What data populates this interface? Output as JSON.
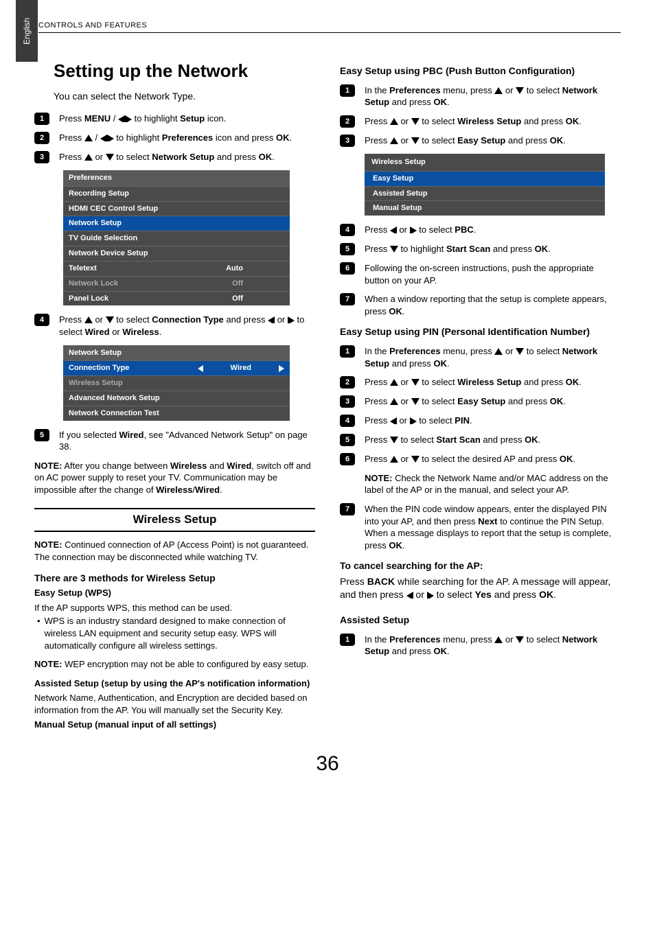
{
  "side_tab": "English",
  "header": "CONTROLS AND FEATURES",
  "page_number": "36",
  "left": {
    "title": "Setting up the Network",
    "intro": "You can select the Network Type.",
    "steps": {
      "s1_a": "Press ",
      "s1_b": "MENU",
      "s1_c": " / ",
      "s1_d": " to highlight ",
      "s1_e": "Setup",
      "s1_f": " icon.",
      "s2_a": "Press ",
      "s2_b": " / ",
      "s2_c": " to highlight ",
      "s2_d": "Preferences",
      "s2_e": " icon and press ",
      "s2_f": "OK",
      "s2_g": ".",
      "s3_a": "Press ",
      "s3_b": " or ",
      "s3_c": " to select ",
      "s3_d": "Network Setup",
      "s3_e": " and press ",
      "s3_f": "OK",
      "s3_g": ".",
      "s4_a": "Press ",
      "s4_b": " or ",
      "s4_c": " to select ",
      "s4_d": "Connection Type",
      "s4_e": " and press ",
      "s4_f": " or ",
      "s4_g": " to select ",
      "s4_h": "Wired",
      "s4_i": " or ",
      "s4_j": "Wireless",
      "s4_k": ".",
      "s5_a": "If you selected ",
      "s5_b": "Wired",
      "s5_c": ", see \"Advanced Network Setup\" on page 38."
    },
    "menu1": {
      "head": "Preferences",
      "rows": [
        {
          "label": "Recording Setup",
          "val": ""
        },
        {
          "label": "HDMI CEC Control Setup",
          "val": ""
        },
        {
          "label": "Network Setup",
          "val": "",
          "selected": true
        },
        {
          "label": "TV Guide Selection",
          "val": ""
        },
        {
          "label": "Network Device Setup",
          "val": ""
        },
        {
          "label": "Teletext",
          "val": "Auto"
        },
        {
          "label": "Network Lock",
          "val": "Off",
          "dim": true
        },
        {
          "label": "Panel Lock",
          "val": "Off"
        }
      ]
    },
    "menu2": {
      "head": "Network Setup",
      "rows": [
        {
          "label": "Connection Type",
          "val": "Wired",
          "selected": true,
          "arrows": true
        },
        {
          "label": "Wireless Setup",
          "val": "",
          "dim": true
        },
        {
          "label": "Advanced Network Setup",
          "val": ""
        },
        {
          "label": "Network Connection Test",
          "val": ""
        }
      ]
    },
    "note1_a": "NOTE:",
    "note1_b": "  After you change between ",
    "note1_c": "Wireless",
    "note1_d": " and ",
    "note1_e": "Wired",
    "note1_f": ", switch off and on AC power supply to reset your TV. Communication may be impossible after the change of ",
    "note1_g": "Wireless",
    "note1_h": "/",
    "note1_i": "Wired",
    "note1_j": ".",
    "section_title": "Wireless Setup",
    "note2_a": "NOTE:",
    "note2_b": " Continued connection of AP (Access Point) is not guaranteed. The connection may be disconnected while watching TV.",
    "methods_head": "There are 3 methods for Wireless Setup",
    "easy_wps": "Easy Setup (WPS)",
    "easy_wps_body": "If the AP supports WPS, this method can be used.",
    "easy_wps_bullet": "WPS is an industry standard designed to make connection of wireless LAN equipment and security setup easy. WPS will automatically configure all wireless settings.",
    "note3_a": "NOTE:",
    "note3_b": "  WEP encryption may not be able to configured by easy setup.",
    "assisted_head": "Assisted Setup (setup by using the AP's notification information)",
    "assisted_body": "Network Name, Authentication, and Encryption are decided based on information from the AP. You will manually set the Security Key.",
    "manual_head": "Manual Setup (manual input of all settings)"
  },
  "right": {
    "pbc_head": "Easy Setup using PBC (Push Button Configuration)",
    "pbc": {
      "s1_a": "In the ",
      "s1_b": "Preferences",
      "s1_c": " menu, press ",
      "s1_d": " or ",
      "s1_e": " to select ",
      "s1_f": "Network Setup",
      "s1_g": " and press ",
      "s1_h": "OK",
      "s1_i": ".",
      "s2_a": "Press ",
      "s2_b": " or ",
      "s2_c": " to select ",
      "s2_d": "Wireless Setup",
      "s2_e": " and press ",
      "s2_f": "OK",
      "s2_g": ".",
      "s3_a": "Press ",
      "s3_b": " or ",
      "s3_c": " to select ",
      "s3_d": "Easy Setup",
      "s3_e": " and press ",
      "s3_f": "OK",
      "s3_g": ".",
      "s4_a": "Press ",
      "s4_b": " or ",
      "s4_c": " to select ",
      "s4_d": "PBC",
      "s4_e": ".",
      "s5_a": "Press ",
      "s5_b": " to highlight ",
      "s5_c": "Start Scan",
      "s5_d": " and press ",
      "s5_e": "OK",
      "s5_f": ".",
      "s6": "Following the on-screen instructions, push the appropriate button on your AP.",
      "s7_a": "When a window reporting that the setup is complete appears, press ",
      "s7_b": "OK",
      "s7_c": "."
    },
    "menu3": {
      "head": "Wireless Setup",
      "rows": [
        {
          "label": "Easy Setup",
          "selected": true
        },
        {
          "label": "Assisted Setup"
        },
        {
          "label": "Manual Setup"
        }
      ]
    },
    "pin_head": "Easy Setup using PIN (Personal Identification Number)",
    "pin": {
      "s1_a": "In the ",
      "s1_b": "Preferences",
      "s1_c": " menu, press ",
      "s1_d": " or ",
      "s1_e": " to select ",
      "s1_f": "Network Setup",
      "s1_g": " and press ",
      "s1_h": "OK",
      "s1_i": ".",
      "s2_a": "Press ",
      "s2_b": " or ",
      "s2_c": " to select ",
      "s2_d": "Wireless Setup",
      "s2_e": " and press ",
      "s2_f": "OK",
      "s2_g": ".",
      "s3_a": "Press ",
      "s3_b": " or ",
      "s3_c": " to select ",
      "s3_d": "Easy Setup",
      "s3_e": " and press ",
      "s3_f": "OK",
      "s3_g": ".",
      "s4_a": "Press ",
      "s4_b": " or ",
      "s4_c": " to select ",
      "s4_d": "PIN",
      "s4_e": ".",
      "s5_a": "Press ",
      "s5_b": " to select ",
      "s5_c": "Start Scan",
      "s5_d": " and press ",
      "s5_e": "OK",
      "s5_f": ".",
      "s6_a": "Press ",
      "s6_b": " or ",
      "s6_c": " to select the desired AP and press ",
      "s6_d": "OK",
      "s6_e": ".",
      "s6_note_a": "NOTE:",
      "s6_note_b": " Check the Network Name and/or  MAC address on the label of the AP or in the manual, and select your AP.",
      "s7_a": "When the PIN code window appears, enter the displayed PIN into your AP, and then press ",
      "s7_b": "Next",
      "s7_c": " to continue the PIN Setup. When a message displays to report that the setup is complete, press ",
      "s7_d": "OK",
      "s7_e": "."
    },
    "cancel_head": "To cancel searching for the AP:",
    "cancel_a": "Press ",
    "cancel_b": "BACK",
    "cancel_c": " while searching for the AP. A message will appear, and then press ",
    "cancel_d": " or ",
    "cancel_e": " to select ",
    "cancel_f": "Yes",
    "cancel_g": " and press ",
    "cancel_h": "OK",
    "cancel_i": ".",
    "assisted_head": "Assisted Setup",
    "assisted": {
      "s1_a": "In the ",
      "s1_b": "Preferences",
      "s1_c": " menu, press ",
      "s1_d": " or ",
      "s1_e": " to select ",
      "s1_f": "Network Setup",
      "s1_g": " and press ",
      "s1_h": "OK",
      "s1_i": "."
    }
  }
}
